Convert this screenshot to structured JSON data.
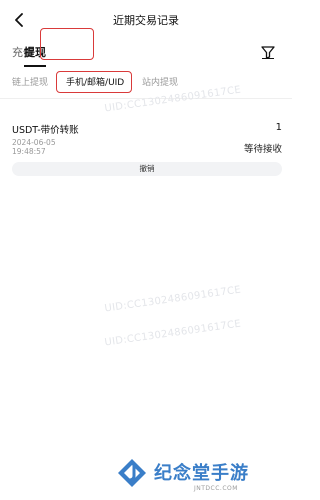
{
  "header": {
    "title": "近期交易记录",
    "back_icon": "chevron-left-icon"
  },
  "tabs": [
    {
      "label": "充值",
      "active": false
    },
    {
      "label": "提现",
      "active": true
    }
  ],
  "filter_icon": "filter-funnel-icon",
  "subtabs": [
    {
      "label": "链上提现",
      "active": false
    },
    {
      "label": "手机/邮箱/UID",
      "active": true
    },
    {
      "label": "站内提现",
      "active": false
    }
  ],
  "record": {
    "title": "USDT-带价转账",
    "amount": "1",
    "date": "2024-06-05",
    "time": "19:48:57",
    "status": "等待接收",
    "cancel_label": "撤销"
  },
  "watermarks": [
    "UID:CC1302486091617CE",
    "UID:CC1302486091617CE",
    "UID:CC1302486091617CE"
  ],
  "brand": {
    "name": "纪念堂手游",
    "url": "JNTDCC.COM"
  },
  "colors": {
    "highlight_box": "#d93a3a",
    "brand_blue": "#3a7ec8"
  }
}
